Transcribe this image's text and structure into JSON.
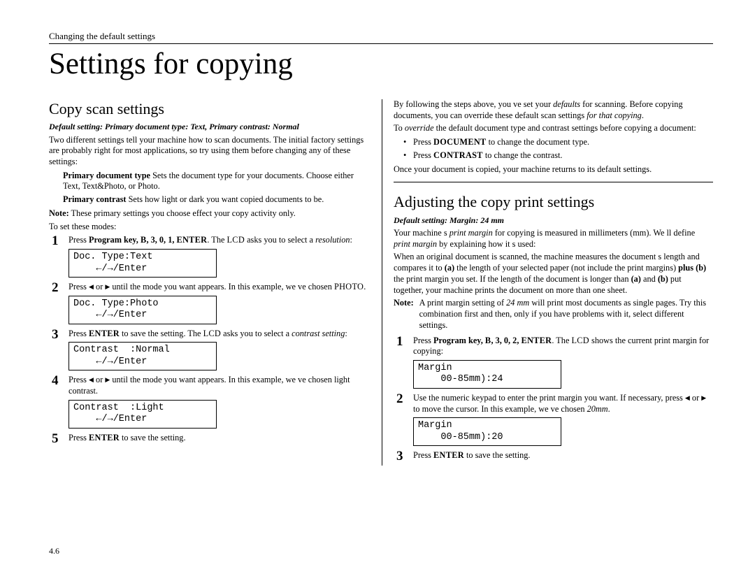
{
  "header": {
    "breadcrumb": "Changing the default settings",
    "title": "Settings for copying"
  },
  "left": {
    "h": "Copy scan settings",
    "def": "Default setting: Primary document type: Text, Primary contrast: Normal",
    "intro": "Two different settings tell your machine how to scan documents. The initial factory settings are probably right for most applications, so try using them before changing any of these settings:",
    "pdt_label": "Primary document type",
    "pdt_body": " Sets the document type for your documents. Choose either Text, Text&Photo, or Photo.",
    "pc_label": "Primary contrast",
    "pc_body": " Sets how light or dark you want copied documents to be.",
    "note1": " These primary settings you choose effect your copy activity only.",
    "lead": "To set these modes:",
    "s1a": "Press ",
    "s1b": "Program key, ",
    "s1c": "B",
    "s1d": ", 3, 0, 1, ",
    "s1e": "ENTER",
    "s1f": ". The ",
    "s1g": "LCD",
    "s1h": " asks you to select a ",
    "s1i": "resolution",
    "s1j": ":",
    "lcd1": "Doc. Type:Text\n    ←/→/Enter",
    "s2a": "Press ",
    "s2b": " or ",
    "s2c": " until the mode you want appears. In this example, we ve chosen ",
    "s2d": "PHOTO",
    "s2e": ".",
    "lcd2": "Doc. Type:Photo\n    ←/→/Enter",
    "s3a": "Press ",
    "s3b": "ENTER",
    "s3c": " to save the setting. The ",
    "s3d": "LCD",
    "s3e": " asks you to select a ",
    "s3f": "contrast setting",
    "s3g": ":",
    "lcd3": "Contrast  :Normal\n    ←/→/Enter",
    "s4a": "Press ",
    "s4b": " or ",
    "s4c": " until the mode you want appears. In this example, we ve chosen light contrast.",
    "lcd4": "Contrast  :Light\n    ←/→/Enter",
    "s5a": "Press ",
    "s5b": "ENTER",
    "s5c": " to save the setting."
  },
  "right": {
    "p1a": "By following the steps above, you ve set your ",
    "p1b": "defaults",
    "p1c": " for scanning. Before copying documents, you can override these default scan settings ",
    "p1d": "for that copying",
    "p1e": ".",
    "p2a": "To ",
    "p2b": "override",
    "p2c": " the default document type and contrast settings before copying a document:",
    "b1a": "Press ",
    "b1b": "DOCUMENT",
    "b1c": " to change the document type.",
    "b2a": "Press ",
    "b2b": "CONTRAST",
    "b2c": " to change the contrast.",
    "p3": "Once your document is copied, your machine returns to its default settings.",
    "h": "Adjusting the copy print settings",
    "def": "Default setting: Margin: 24 mm",
    "p4a": "Your machine s ",
    "p4b": "print margin",
    "p4c": " for copying is measured in millimeters (mm). We ll define ",
    "p4d": "print margin",
    "p4e": " by explaining how it s used:",
    "p5a": "When an original document is scanned, the machine measures the document s length and compares it to ",
    "p5b": "(a)",
    "p5c": " the length of your selected paper (not include the print margins) ",
    "p5d": "plus (b)",
    "p5e": " the print margin you set. If the length of the document is longer than ",
    "p5f": "(a)",
    "p5g": " and ",
    "p5h": "(b)",
    "p5i": " put together, your machine prints the document on more than one sheet.",
    "note2a": "A print margin setting of ",
    "note2b": "24 mm",
    "note2c": " will print most documents as single pages. Try this combination first and then, only if you have problems with it, select different settings.",
    "s1a": "Press ",
    "s1b": "Program key, ",
    "s1c": "B",
    "s1d": ", 3, 0, 2, ",
    "s1e": "ENTER",
    "s1f": ". The ",
    "s1g": "LCD",
    "s1h": " shows the current print margin for copying:",
    "lcd1": "Margin\n    00-85mm):24",
    "s2a": "Use the numeric keypad to enter the print margin you want. If necessary, press ",
    "s2b": " or ",
    "s2c": " to move the cursor. In this example, we ve chosen ",
    "s2d": "20mm",
    "s2e": ".",
    "lcd2": "Margin\n    00-85mm):20",
    "s3a": "Press ",
    "s3b": "ENTER",
    "s3c": " to save the setting."
  },
  "pagenum": "4.6"
}
